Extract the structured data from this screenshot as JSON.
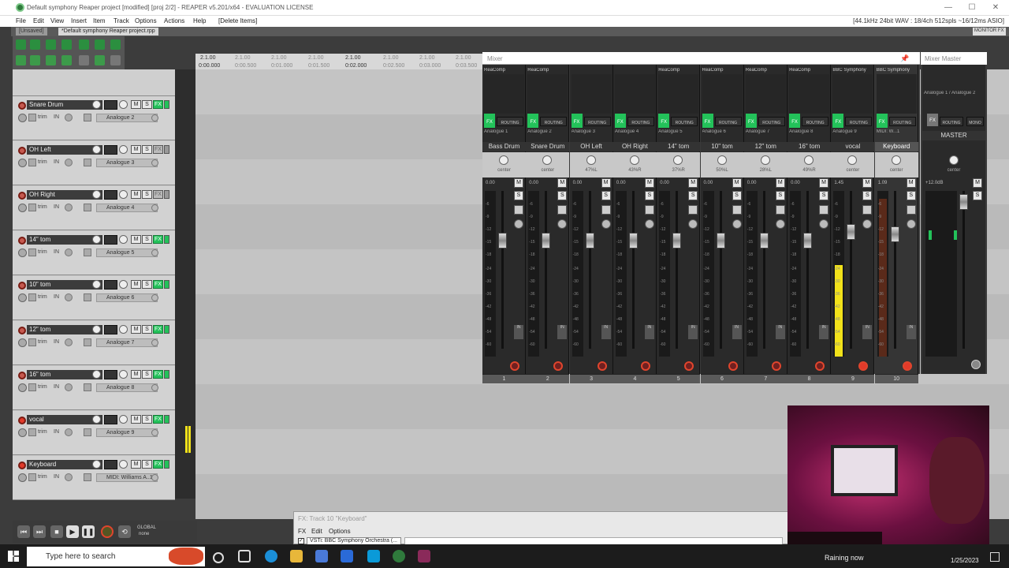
{
  "window": {
    "title": "Default symphony Reaper project [modified] [proj 2/2] - REAPER v5.201/x64 - EVALUATION LICENSE",
    "minimize": "—",
    "maximize": "☐",
    "close": "✕"
  },
  "menu": {
    "items": [
      "File",
      "Edit",
      "View",
      "Insert",
      "Item",
      "Track",
      "Options",
      "Actions",
      "Help",
      "[Delete Items]"
    ],
    "status": "[44.1kHz 24bit WAV : 18/4ch 512spls ~16/12ms ASIO]"
  },
  "project_tabs": [
    "[Unsaved]",
    "*Default symphony Reaper project.rpp"
  ],
  "monitor_fx": "MONITOR FX",
  "ruler": {
    "top": [
      "2.1.00",
      "2.1.00",
      "2.1.00",
      "2.1.00",
      "2.1.00",
      "2.1.00",
      "2.1.00",
      "2.1.00"
    ],
    "bottom": [
      "0:00.000",
      "0:00.500",
      "0:01.000",
      "0:01.500",
      "0:02.000",
      "0:02.500",
      "0:03.000",
      "0:03.500"
    ]
  },
  "tracks": [
    {
      "name": "Snare Drum",
      "input": "Analogue 2",
      "num": "2",
      "fx": true,
      "armed": false
    },
    {
      "name": "OH Left",
      "input": "Analogue 3",
      "num": "3",
      "fx": false,
      "armed": false
    },
    {
      "name": "OH Right",
      "input": "Analogue 4",
      "num": "4",
      "fx": false,
      "armed": false
    },
    {
      "name": "14\" tom",
      "input": "Analogue 5",
      "num": "5",
      "fx": true,
      "armed": false
    },
    {
      "name": "10\" tom",
      "input": "Analogue 6",
      "num": "6",
      "fx": true,
      "armed": false
    },
    {
      "name": "12\" tom",
      "input": "Analogue 7",
      "num": "7",
      "fx": true,
      "armed": false
    },
    {
      "name": "16\" tom",
      "input": "Analogue 8",
      "num": "8",
      "fx": true,
      "armed": false
    },
    {
      "name": "vocal",
      "input": "Analogue 9",
      "num": "9",
      "fx": true,
      "armed": true
    },
    {
      "name": "Keyboard",
      "input": "MIDI: Williams A..1",
      "num": "10",
      "fx": true,
      "armed": true
    }
  ],
  "track_labels": {
    "trim": "trim",
    "in": "IN",
    "mute": "M",
    "solo": "S",
    "fx": "FX",
    "route": "ROUTE"
  },
  "mixer": {
    "title": "Mixer",
    "master_title": "Mixer Master",
    "strips": [
      {
        "name": "Bass Drum",
        "fx": "ReaComp",
        "input": "Analogue 1",
        "pan": "center",
        "vol": "0.00",
        "num": "1"
      },
      {
        "name": "Snare Drum",
        "fx": "ReaComp",
        "input": "Analogue 2",
        "pan": "center",
        "vol": "0.00",
        "num": "2"
      },
      {
        "name": "OH Left",
        "fx": "",
        "input": "Analogue 3",
        "pan": "47%L",
        "vol": "0.00",
        "num": "3"
      },
      {
        "name": "OH Right",
        "fx": "",
        "input": "Analogue 4",
        "pan": "43%R",
        "vol": "0.00",
        "num": "4"
      },
      {
        "name": "14\" tom",
        "fx": "ReaComp",
        "input": "Analogue 5",
        "pan": "37%R",
        "vol": "0.00",
        "num": "5"
      },
      {
        "name": "10\" tom",
        "fx": "ReaComp",
        "input": "Analogue 6",
        "pan": "50%L",
        "vol": "0.00",
        "num": "6"
      },
      {
        "name": "12\" tom",
        "fx": "ReaComp",
        "input": "Analogue 7",
        "pan": "28%L",
        "vol": "0.00",
        "num": "7"
      },
      {
        "name": "16\" tom",
        "fx": "ReaComp",
        "input": "Analogue 8",
        "pan": "49%R",
        "vol": "0.00",
        "num": "8"
      },
      {
        "name": "vocal",
        "fx": "BBC Symphony",
        "input": "Analogue 9",
        "pan": "center",
        "vol": "1.45",
        "num": "9"
      },
      {
        "name": "Keyboard",
        "fx": "BBC Symphony",
        "input": "MIDI: W...1",
        "pan": "center",
        "vol": "1.09",
        "num": "10"
      }
    ],
    "master": {
      "name": "MASTER",
      "input": "Analogue 1 / Analogue 2",
      "pan": "center",
      "vol": "+12.0dB",
      "mono": "MONO",
      "routing": "ROUTING"
    },
    "scale": [
      "-6",
      "-9",
      "-12",
      "-15",
      "-18",
      "-24",
      "-30",
      "-36",
      "-42",
      "-48",
      "-54",
      "-60"
    ],
    "mute": "M",
    "solo": "S",
    "routing": "ROUTING"
  },
  "transport": {
    "global": "GLOBAL",
    "none": "none"
  },
  "fx_window": {
    "title": "FX: Track 10 \"Keyboard\"",
    "menu": [
      "FX",
      "Edit",
      "Options"
    ],
    "plugin": "VSTi: BBC Symphony Orchestra (..."
  },
  "taskbar": {
    "search_placeholder": "Type here to search",
    "weather": "Raining now",
    "date": "1/25/2023"
  },
  "colors": {
    "accent_green": "#23c25a",
    "record_red": "#d03a2c",
    "meter_yellow": "#f2e21a"
  },
  "meter_levels": {
    "vocal": 0.55,
    "keyboard": 0.95
  }
}
